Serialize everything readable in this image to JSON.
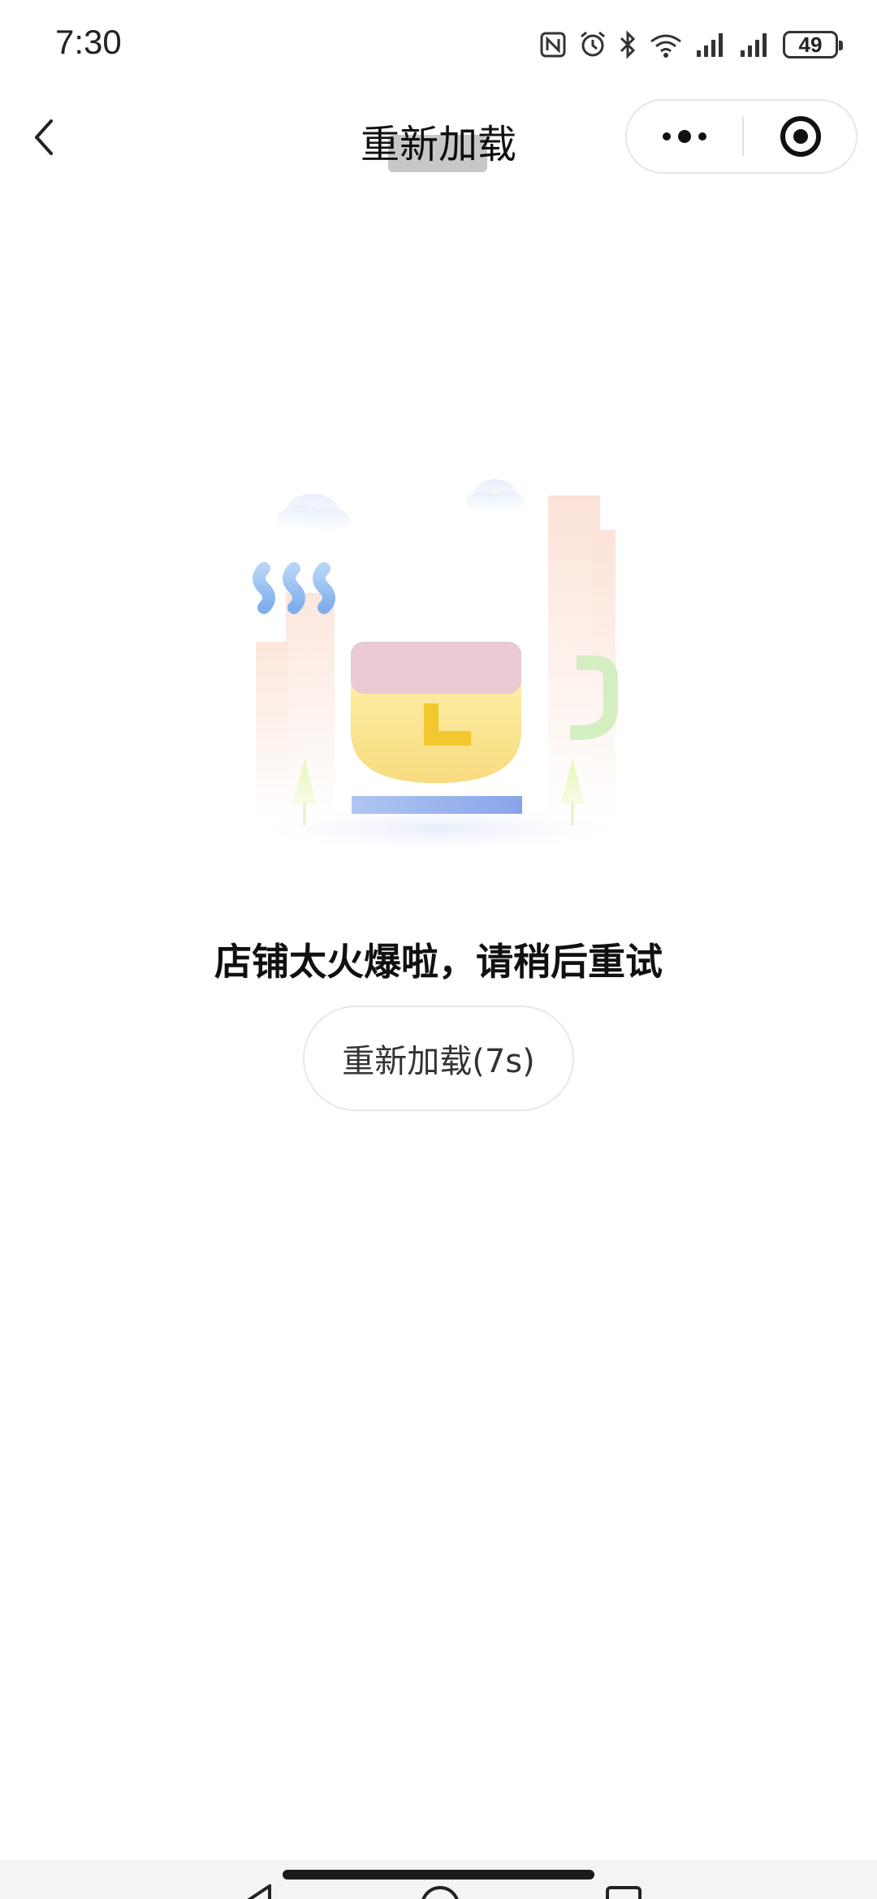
{
  "status_bar": {
    "time": "7:30",
    "battery": "49",
    "icons": [
      "nfc-icon",
      "alarm-icon",
      "bluetooth-icon",
      "wifi-icon",
      "signal-icon",
      "signal-icon",
      "battery-icon"
    ]
  },
  "nav": {
    "title": "重新加载",
    "back_icon": "back-arrow-icon",
    "more_icon": "more-dots-icon",
    "close_icon": "close-target-icon"
  },
  "main": {
    "illustration": "busy-coffee-cup-illustration",
    "message": "店铺太火爆啦，请稍后重试",
    "reload_button_label": "重新加载(7s)"
  },
  "colors": {
    "cup_body": "#FBE79A",
    "cup_rim": "#E9C9D3",
    "steam": "#8DBAF0",
    "handle": "#CDEBB4",
    "saucer": "#93AEEB",
    "clock_hand": "#F2C82E"
  }
}
